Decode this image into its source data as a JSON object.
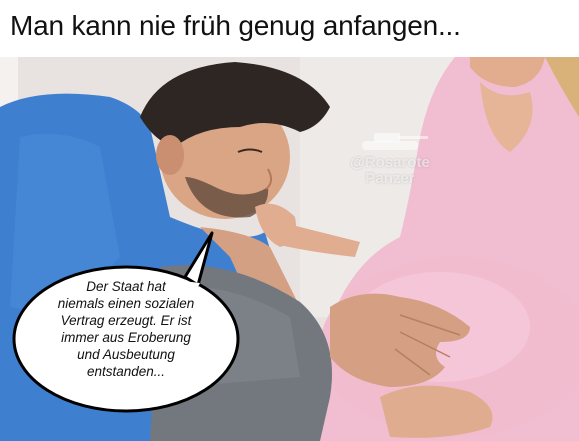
{
  "caption": "Man kann nie früh genug anfangen...",
  "watermark": {
    "handle": "@Rosarote",
    "name": "Panzer",
    "icon": "tank-icon"
  },
  "speech_bubble": {
    "lines": [
      "Der Staat hat",
      "niemals einen sozialen",
      "Vertrag erzeugt. Er ist",
      "immer aus Eroberung",
      "und Ausbeutung",
      "entstanden..."
    ]
  },
  "colors": {
    "shirt_man": "#3f7fd0",
    "shirt_woman": "#f2bfd3",
    "skin": "#d9a585",
    "background": "#e9e4e2",
    "bubble": "#ffffff",
    "bubble_outline": "#000000"
  }
}
